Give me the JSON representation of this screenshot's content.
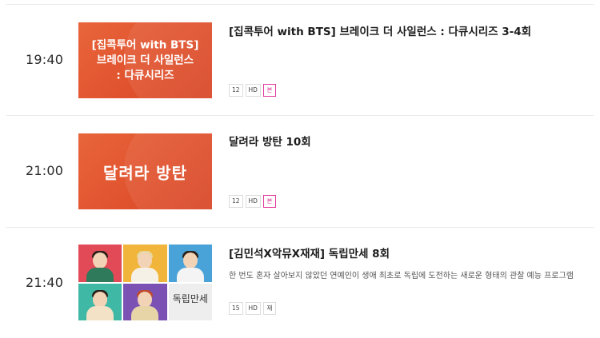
{
  "colors": {
    "accent": "#e0379a",
    "thumb_orange": "#e05a30"
  },
  "programs": [
    {
      "time": "19:40",
      "title": "[집콕투어 with BTS] 브레이크 더 사일런스 : 다큐시리즈 3-4회",
      "thumb_lines": [
        "[집콕투어 with BTS]",
        "브레이크 더 사일런스",
        ": 다큐시리즈"
      ],
      "badges": [
        "12",
        "HD",
        "본"
      ]
    },
    {
      "time": "21:00",
      "title": "달려라 방탄 10회",
      "thumb_lines": [
        "달려라 방탄"
      ],
      "badges": [
        "12",
        "HD",
        "본"
      ]
    },
    {
      "time": "21:40",
      "title": "[김민석X악뮤X재재] 독립만세 8회",
      "description": "한 번도 혼자 살아보지 않았던 연예인이 생애 최초로 독립에 도전하는 새로운 형태의 관찰 예능 프로그램",
      "thumb_logo": "독립만세",
      "badges": [
        "15",
        "HD",
        "재"
      ]
    }
  ]
}
